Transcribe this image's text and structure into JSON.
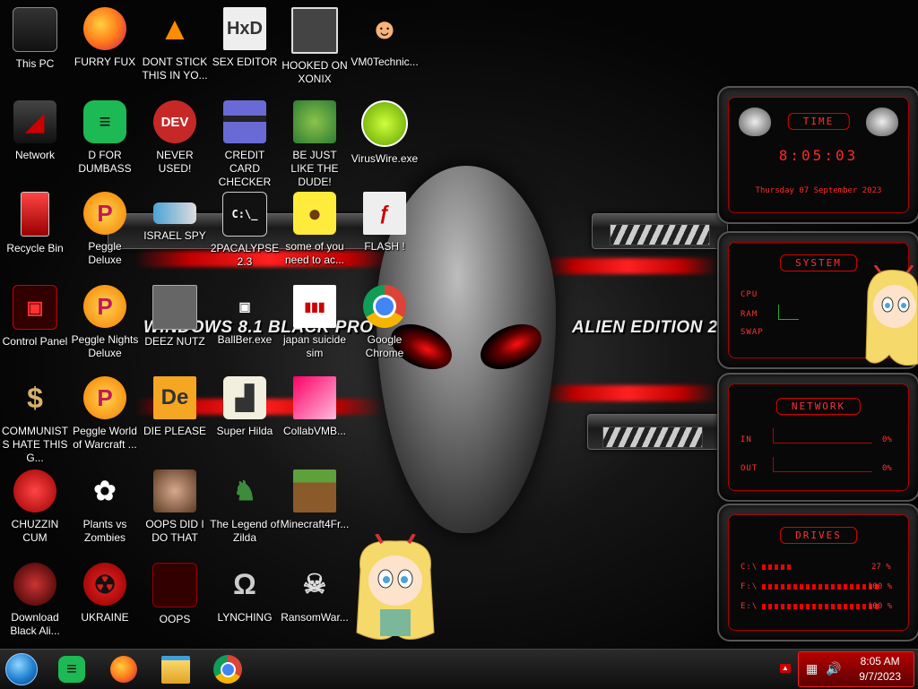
{
  "wallpaper": {
    "text_left": "WINDOWS 8.1 BLACK PRO",
    "text_right": "ALIEN EDITION 20"
  },
  "desktop_icons": [
    {
      "label": "This PC"
    },
    {
      "label": "FURRY FUX"
    },
    {
      "label": "DONT STICK THIS IN YO..."
    },
    {
      "label": "SEX EDITOR"
    },
    {
      "label": "HOOKED ON XONIX"
    },
    {
      "label": "VM0Technic..."
    },
    {
      "label": "Network"
    },
    {
      "label": "D FOR DUMBASS"
    },
    {
      "label": "NEVER USED!"
    },
    {
      "label": "CREDIT CARD CHECKER"
    },
    {
      "label": "BE JUST LIKE THE DUDE!"
    },
    {
      "label": "VirusWire.exe"
    },
    {
      "label": "Recycle Bin"
    },
    {
      "label": "Peggle Deluxe"
    },
    {
      "label": "ISRAEL SPY"
    },
    {
      "label": "2PACALYPSE 2.3"
    },
    {
      "label": "some of you need to ac..."
    },
    {
      "label": "FLASH !"
    },
    {
      "label": "Control Panel"
    },
    {
      "label": "Peggle Nights Deluxe"
    },
    {
      "label": "DEEZ NUTZ"
    },
    {
      "label": "BallBer.exe"
    },
    {
      "label": "japan suicide sim"
    },
    {
      "label": "Google Chrome"
    },
    {
      "label": "COMMUNISTS HATE THIS G..."
    },
    {
      "label": "Peggle World of Warcraft ..."
    },
    {
      "label": "DIE PLEASE"
    },
    {
      "label": "Super Hilda"
    },
    {
      "label": "CollabVMB..."
    },
    {
      "label": "CHUZZIN CUM"
    },
    {
      "label": "Plants vs Zombies"
    },
    {
      "label": "OOPS DID I DO THAT"
    },
    {
      "label": "The Legend of Zilda"
    },
    {
      "label": "Minecraft4Fr..."
    },
    {
      "label": "Download Black Ali..."
    },
    {
      "label": "UKRAINE"
    },
    {
      "label": "OOPS"
    },
    {
      "label": "LYNCHING"
    },
    {
      "label": "RansomWar..."
    }
  ],
  "gadgets": {
    "time": {
      "title": "TIME",
      "clock": "8:05:03",
      "date": "Thursday 07 September 2023"
    },
    "system": {
      "title": "SYSTEM",
      "labels": [
        "CPU",
        "RAM",
        "SWAP"
      ]
    },
    "network": {
      "title": "NETWORK",
      "in_label": "IN",
      "in_value": "0%",
      "out_label": "OUT",
      "out_value": "0%"
    },
    "drives": {
      "title": "DRIVES",
      "rows": [
        {
          "label": "C:\\",
          "value": "27 %",
          "fill": 0.27
        },
        {
          "label": "F:\\",
          "value": "100 %",
          "fill": 1.0
        },
        {
          "label": "E:\\",
          "value": "100 %",
          "fill": 1.0
        }
      ]
    }
  },
  "taskbar": {
    "apps": [
      "start-orb",
      "spotify",
      "firefox",
      "file-explorer",
      "chrome"
    ],
    "clock_time": "8:05 AM",
    "clock_date": "9/7/2023"
  },
  "colors": {
    "accent": "#d00000",
    "tray": "#a00000"
  }
}
